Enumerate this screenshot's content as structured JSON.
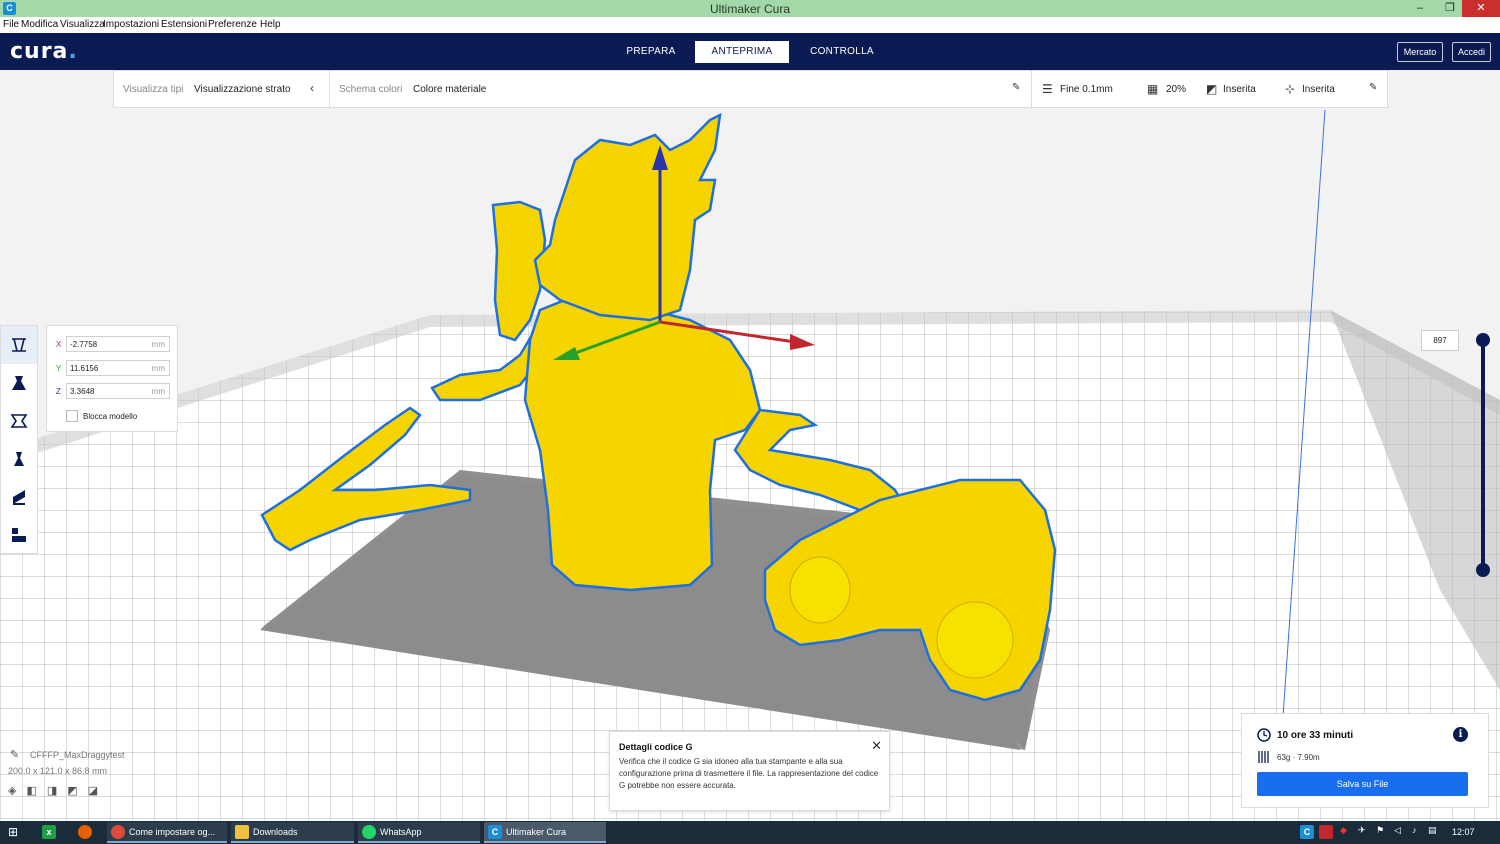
{
  "window": {
    "title": "Ultimaker Cura",
    "app_icon": "C",
    "controls": [
      "–",
      "❐",
      "✕"
    ]
  },
  "menubar": [
    "File",
    "Modifica",
    "Visualizza",
    "Impostazioni",
    "Estensioni",
    "Preferenze",
    "Help"
  ],
  "header": {
    "logo": "cura",
    "logo_dot": ".",
    "tabs": [
      {
        "label": "PREPARA",
        "active": false
      },
      {
        "label": "ANTEPRIMA",
        "active": true
      },
      {
        "label": "CONTROLLA",
        "active": false
      }
    ],
    "marketplace": "Mercato",
    "signin": "Accedi"
  },
  "settings": {
    "view_type_label": "Visualizza tipi",
    "view_type_value": "Visualizzazione strato",
    "color_scheme_label": "Schema colori",
    "color_scheme_value": "Colore materiale",
    "quality": "Fine 0.1mm",
    "infill": "20%",
    "support": "Inserita",
    "adhesion": "Inserita"
  },
  "transform": {
    "x_label": "X",
    "x_value": "-2.7758",
    "y_label": "Y",
    "y_value": "11.6156",
    "z_label": "Z",
    "z_value": "3.3648",
    "unit": "mm",
    "lock_label": "Blocca modello",
    "lock_checked": false
  },
  "layer": {
    "current": "897"
  },
  "object": {
    "name": "CFFFP_MaxDraggytest",
    "dimensions": "200.0 x 121.0 x 86.8 mm"
  },
  "gcode_popup": {
    "title": "Dettagli codice G",
    "body": "Verifica che il codice G sia idoneo alla tua stampante e alla sua configurazione prima di trasmettere il file. La rappresentazione del codice G potrebbe non essere accurata.",
    "close": "✕"
  },
  "print": {
    "time": "10 ore 33 minuti",
    "material": "63g · 7.90m",
    "save_button": "Salva su File",
    "info": "i"
  },
  "taskbar": {
    "items": [
      "Come impostare og...",
      "Downloads",
      "WhatsApp",
      "Ultimaker Cura"
    ],
    "clock": "12:07"
  },
  "colors": {
    "header_bg": "#0a1a52",
    "accent": "#196ef0",
    "model_yellow": "#f5d400",
    "outline_blue": "#1e6fe0",
    "titlebar": "#a3d9a8"
  }
}
